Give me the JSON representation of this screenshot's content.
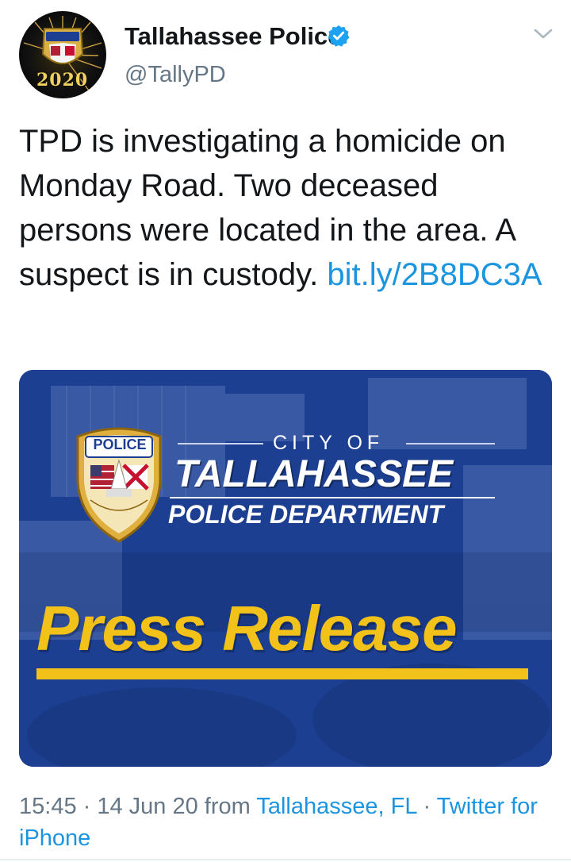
{
  "tweet": {
    "display_name": "Tallahassee Police",
    "handle": "@TallyPD",
    "verified_icon": "verified-badge-icon",
    "menu_icon": "chevron-down-icon",
    "avatar": {
      "badge_text": "POLICE",
      "year": "2020"
    },
    "text": "TPD is investigating a homicide on Monday Road. Two deceased persons were located in the area. A suspect is in custody. ",
    "link_text": "bit.ly/​2B8DC3A",
    "time": "15:45",
    "sep1": " · ",
    "date": "14 Jun 20",
    "from_label": " from ",
    "location": "Tallahassee, FL",
    "sep2": " · ",
    "source": "Twitter for iPhone"
  },
  "card": {
    "badge_label": "POLICE",
    "city_of": "CITY OF",
    "city_name": "TALLAHASSEE",
    "department": "POLICE DEPARTMENT",
    "headline": "Press Release"
  },
  "colors": {
    "link": "#1b95e0",
    "secondary_text": "#657786",
    "card_blue": "#1d3f91",
    "press_yellow": "#f2c21a"
  }
}
